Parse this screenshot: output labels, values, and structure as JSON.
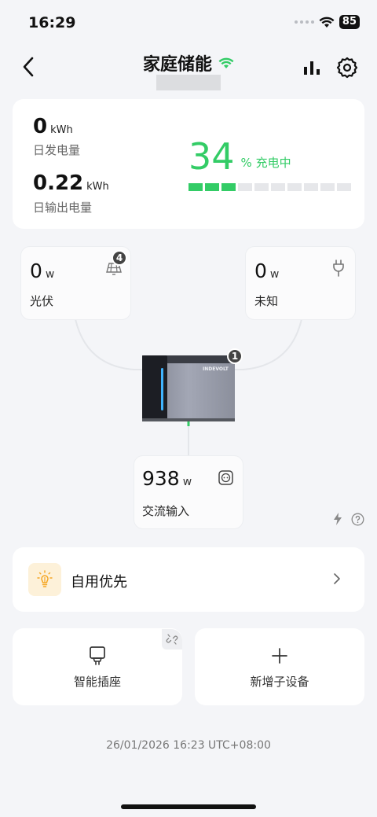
{
  "status_bar": {
    "time": "16:29",
    "battery": "85"
  },
  "header": {
    "title": "家庭储能"
  },
  "summary": {
    "daily_generation_value": "0",
    "daily_generation_unit": "kWh",
    "daily_generation_label": "日发电量",
    "daily_output_value": "0.22",
    "daily_output_unit": "kWh",
    "daily_output_label": "日输出电量",
    "soc_value": "34",
    "soc_text": "% 充电中",
    "soc_fraction": 0.34
  },
  "flow": {
    "pv": {
      "value": "0",
      "unit": "w",
      "label": "光伏",
      "badge": "4"
    },
    "unknown": {
      "value": "0",
      "unit": "w",
      "label": "未知"
    },
    "device": {
      "badge": "1",
      "brand": "INDEVOLT"
    },
    "ac_input": {
      "value": "938",
      "unit": "w",
      "label": "交流输入"
    }
  },
  "mode": {
    "label": "自用优先"
  },
  "tiles": {
    "smart_plug": "智能插座",
    "add_device": "新增子设备"
  },
  "footer": {
    "timestamp": "26/01/2026 16:23  UTC+08:00"
  },
  "colors": {
    "accent": "#33cc66",
    "mode_icon": "#f5a623"
  }
}
